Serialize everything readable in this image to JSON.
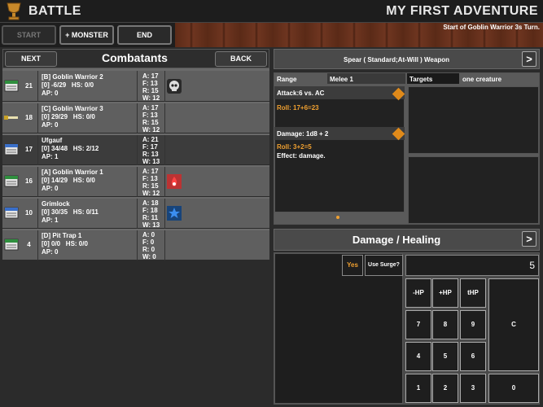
{
  "title_bar": {
    "section": "BATTLE",
    "adventure": "MY FIRST ADVENTURE"
  },
  "toolbar": {
    "start_label": "START",
    "monster_label": "+ MONSTER",
    "end_label": "END",
    "status": "Start of Goblin Warrior 3s Turn."
  },
  "combatants_panel": {
    "next_label": "NEXT",
    "title": "Combatants",
    "back_label": "BACK",
    "rows": [
      {
        "init": "21",
        "name": "[B] Goblin Warrior 2",
        "hp": "[0] -6/29",
        "hs": "HS: 0/0",
        "ap": "AP:  0",
        "a": "A:  17",
        "f": "F:  13",
        "r": "R:  15",
        "w": "W:  12",
        "icon": "sheet-icon",
        "condition": "skull-icon"
      },
      {
        "init": "18",
        "name": "[C] Goblin Warrior 3",
        "hp": "[0] 29/29",
        "hs": "HS: 0/0",
        "ap": "AP:  0",
        "a": "A:  17",
        "f": "F:  13",
        "r": "R:  15",
        "w": "W:  12",
        "icon": "sword-icon",
        "condition": ""
      },
      {
        "init": "17",
        "name": "Ufgauf",
        "hp": "[0] 34/48",
        "hs": "HS: 2/12",
        "ap": "AP:  1",
        "a": "A:  21",
        "f": "F:  17",
        "r": "R:  13",
        "w": "W:  13",
        "icon": "sheet-icon",
        "condition": ""
      },
      {
        "init": "16",
        "name": "[A] Goblin Warrior 1",
        "hp": "[0] 14/29",
        "hs": "HS: 0/0",
        "ap": "AP:  0",
        "a": "A:  17",
        "f": "F:  13",
        "r": "R:  15",
        "w": "W:  12",
        "icon": "sheet-icon",
        "condition": "fire-icon"
      },
      {
        "init": "10",
        "name": "Grimlock",
        "hp": "[0] 30/35",
        "hs": "HS: 0/11",
        "ap": "AP:  1",
        "a": "A:  18",
        "f": "F:  18",
        "r": "R:  11",
        "w": "W:  13",
        "icon": "sheet-icon",
        "condition": "star-icon"
      },
      {
        "init": "4",
        "name": "[D] Pit Trap 1",
        "hp": "[0] 0/0",
        "hs": "HS: 0/0",
        "ap": "AP:  0",
        "a": "A:  0",
        "f": "F:  0",
        "r": "R:  0",
        "w": "W:  0",
        "icon": "sheet-icon",
        "condition": ""
      }
    ]
  },
  "power_panel": {
    "title": "Spear ( Standard;At-Will ) Weapon",
    "range_label": "Range",
    "range_value": "Melee 1",
    "targets_label": "Targets",
    "targets_value": "one creature",
    "attack": "Attack:6 vs. AC",
    "attack_roll": "Roll: 17+6=23",
    "damage": "Damage: 1d8 + 2",
    "damage_roll": "Roll: 3+2=5",
    "effect": "Effect: damage."
  },
  "damage_panel": {
    "title": "Damage / Healing",
    "yes_label": "Yes",
    "surge_label": "Use Surge?",
    "amount": "5",
    "keys": {
      "minus_hp": "-HP",
      "plus_hp": "+HP",
      "thp": "tHP",
      "clear": "C",
      "zero": "0",
      "digits": [
        "7",
        "8",
        "9",
        "4",
        "5",
        "6",
        "1",
        "2",
        "3"
      ]
    }
  },
  "colors": {
    "accent_orange": "#f0a030",
    "panel_gray": "#5f5f5f",
    "active_row": "#3c3c3c",
    "wood": "#5a2a17"
  }
}
